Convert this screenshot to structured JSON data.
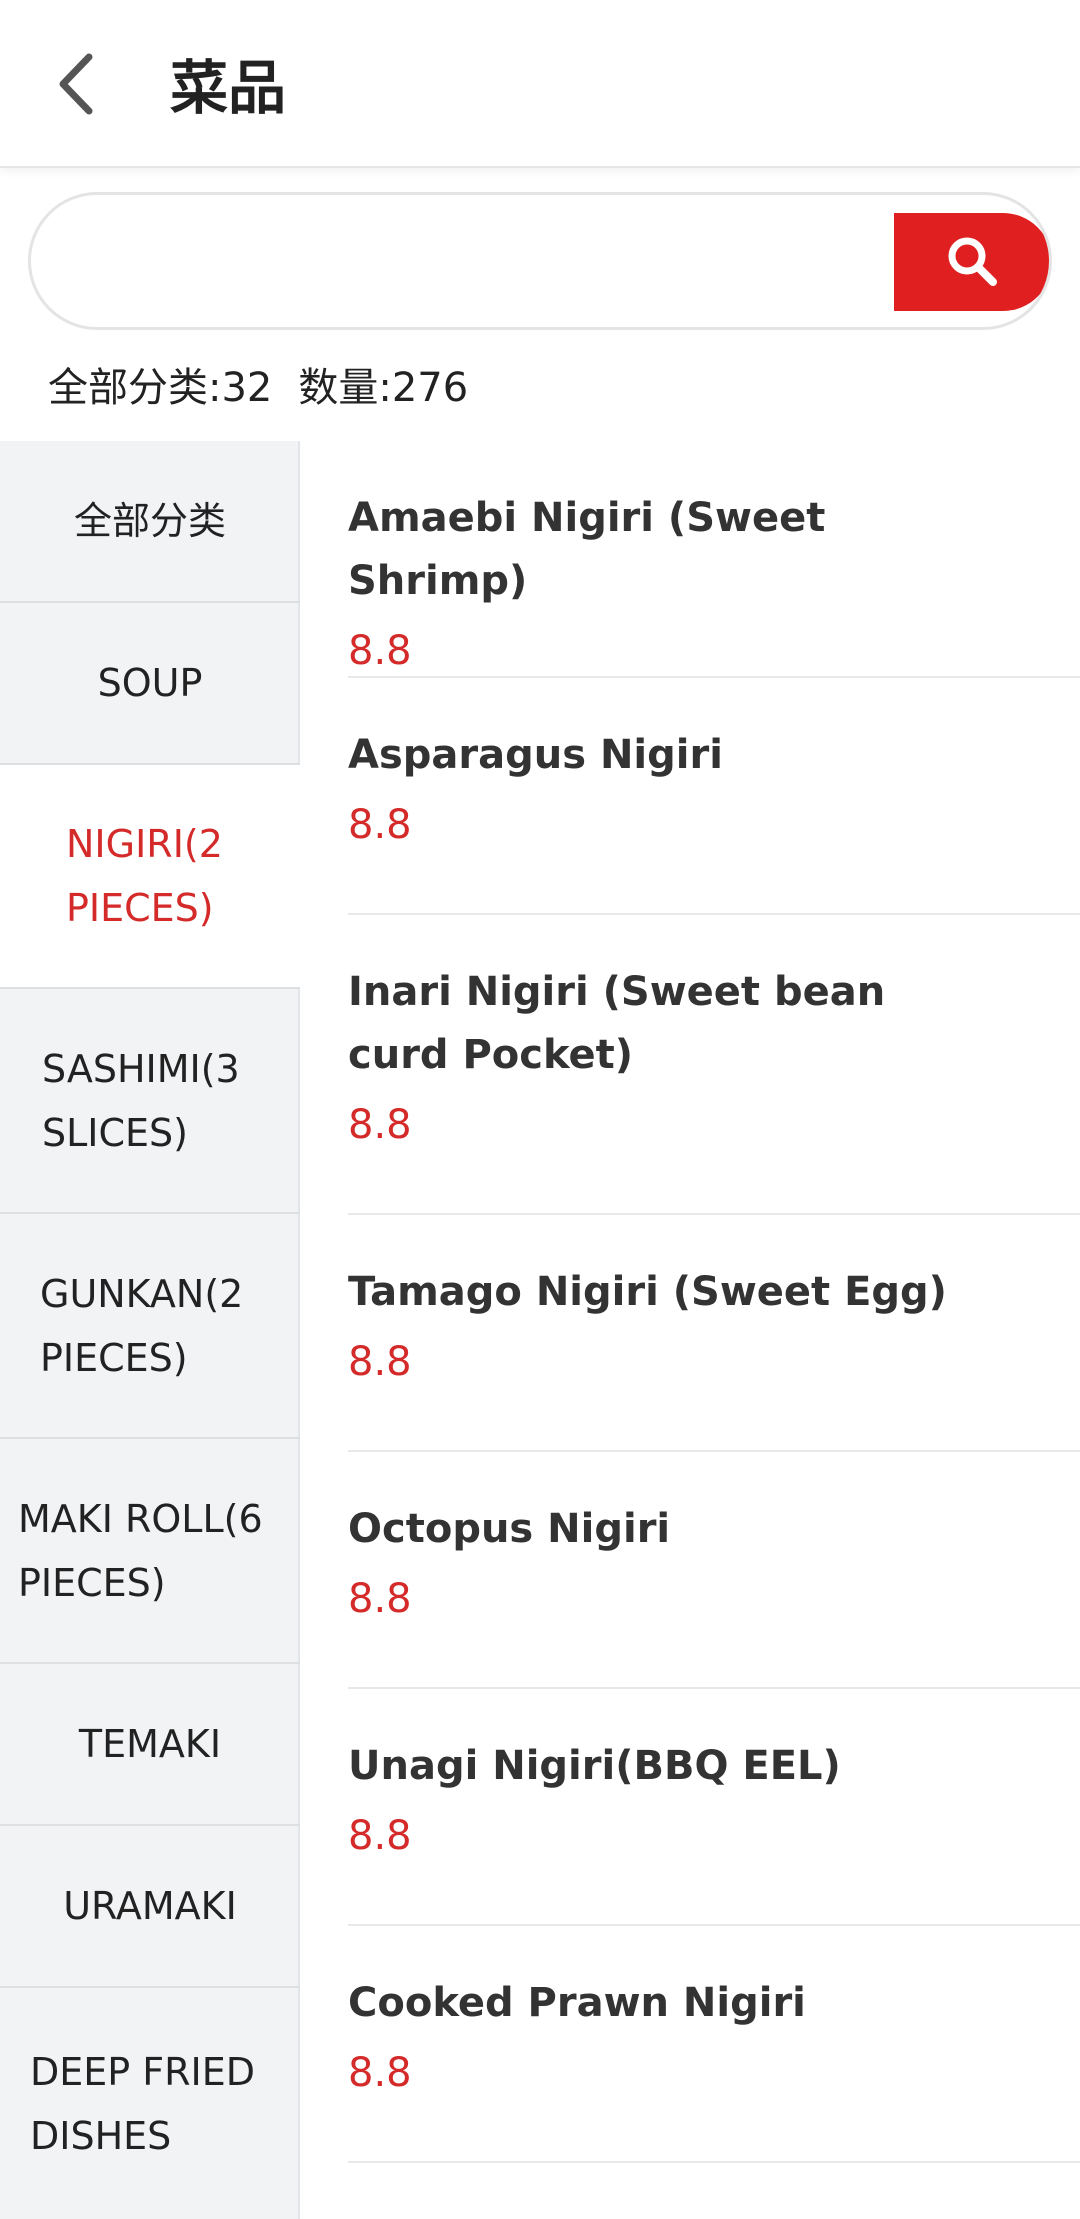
{
  "header": {
    "title": "菜品"
  },
  "search": {
    "value": "",
    "placeholder": ""
  },
  "summary": {
    "categories": "全部分类:32",
    "count": "数量:276"
  },
  "sidebar": {
    "items": [
      {
        "label": "全部分类"
      },
      {
        "label": "SOUP"
      },
      {
        "label": "NIGIRI(2 PIECES)"
      },
      {
        "label": "SASHIMI(3 SLICES)"
      },
      {
        "label": "GUNKAN(2 PIECES)"
      },
      {
        "label": "MAKI ROLL(6 PIECES)"
      },
      {
        "label": "TEMAKI"
      },
      {
        "label": "URAMAKI"
      },
      {
        "label": "DEEP FRIED DISHES"
      }
    ]
  },
  "dishes": [
    {
      "name": "Amaebi Nigiri (Sweet Shrimp)",
      "price": "8.8"
    },
    {
      "name": "Asparagus Nigiri",
      "price": "8.8"
    },
    {
      "name": "Inari Nigiri (Sweet bean curd Pocket)",
      "price": "8.8"
    },
    {
      "name": "Tamago Nigiri (Sweet Egg)",
      "price": "8.8"
    },
    {
      "name": "Octopus Nigiri",
      "price": "8.8"
    },
    {
      "name": "Unagi Nigiri(BBQ EEL)",
      "price": "8.8"
    },
    {
      "name": "Cooked Prawn Nigiri",
      "price": "8.8"
    }
  ],
  "colors": {
    "accent": "#e02020",
    "price": "#d42a2a",
    "sidebar_bg": "#f1f3f5"
  },
  "icons": {
    "back": "chevron-left-icon",
    "search": "search-icon"
  }
}
